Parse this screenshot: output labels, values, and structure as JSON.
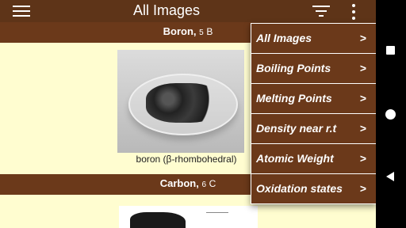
{
  "appbar": {
    "title": "All Images"
  },
  "elements": [
    {
      "name": "Boron",
      "number": "5",
      "symbol": "B",
      "image_caption": "boron (β-rhombohedral)"
    },
    {
      "name": "Carbon",
      "number": "6",
      "symbol": "C"
    }
  ],
  "menu": {
    "items": [
      {
        "label": "All Images",
        "arrow": ">"
      },
      {
        "label": "Boiling Points",
        "arrow": ">"
      },
      {
        "label": "Melting Points",
        "arrow": ">"
      },
      {
        "label": "Density near r.t",
        "arrow": ">"
      },
      {
        "label": "Atomic Weight",
        "arrow": ">"
      },
      {
        "label": "Oxidation states",
        "arrow": ">"
      }
    ]
  },
  "colors": {
    "bar": "#6b391a",
    "background": "#fffdd0",
    "text_light": "#ffffff"
  },
  "icons": [
    "hamburger-menu-icon",
    "filter-icon",
    "more-vert-icon",
    "recents-icon",
    "home-icon",
    "back-icon"
  ]
}
